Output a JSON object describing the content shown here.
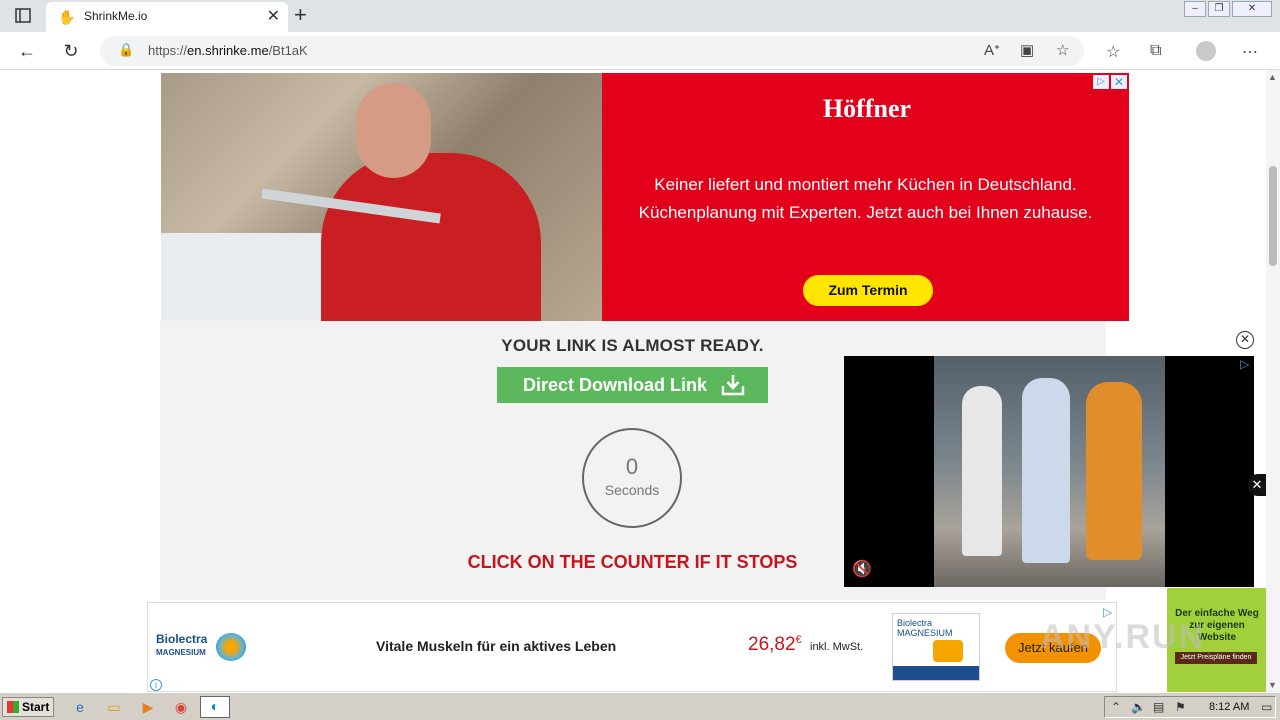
{
  "browser": {
    "tab_title": "ShrinkMe.io",
    "tab_close": "✕",
    "new_tab": "+",
    "url_prefix": "https://",
    "url_domain": "en.shrinke.me",
    "url_path": "/Bt1aK"
  },
  "top_ad": {
    "brand": "Höffner",
    "line1": "Keiner liefert und montiert mehr Küchen in Deutschland.",
    "line2": "Küchenplanung mit Experten. Jetzt auch bei Ihnen zuhause.",
    "cta": "Zum Termin"
  },
  "main": {
    "heading": "YOUR LINK IS ALMOST READY.",
    "download_label": "Direct Download Link",
    "counter_value": "0",
    "counter_unit": "Seconds",
    "note": "CLICK ON THE COUNTER IF IT STOPS"
  },
  "bottom_ad": {
    "brand": "Biolectra",
    "brand_sub": "MAGNESIUM",
    "slogan": "Vitale Muskeln für ein aktives Leben",
    "price": "26,82",
    "currency": "€",
    "tax_note": "inkl. MwSt.",
    "pack_title": "Biolectra",
    "pack_sub": "MAGNESIUM",
    "cta": "Jetzt kaufen"
  },
  "side_ad": {
    "text": "Der einfache Weg zur eigenen Website",
    "cta": "Jetzt Preispläne finden"
  },
  "watermark": "ANY.RUN",
  "taskbar": {
    "start_label": "Start",
    "clock": "8:12 AM"
  },
  "colors": {
    "download_green": "#5cb85c",
    "note_red": "#c4161c",
    "hoffner_red": "#e2001a",
    "cta_yellow": "#ffe500"
  }
}
